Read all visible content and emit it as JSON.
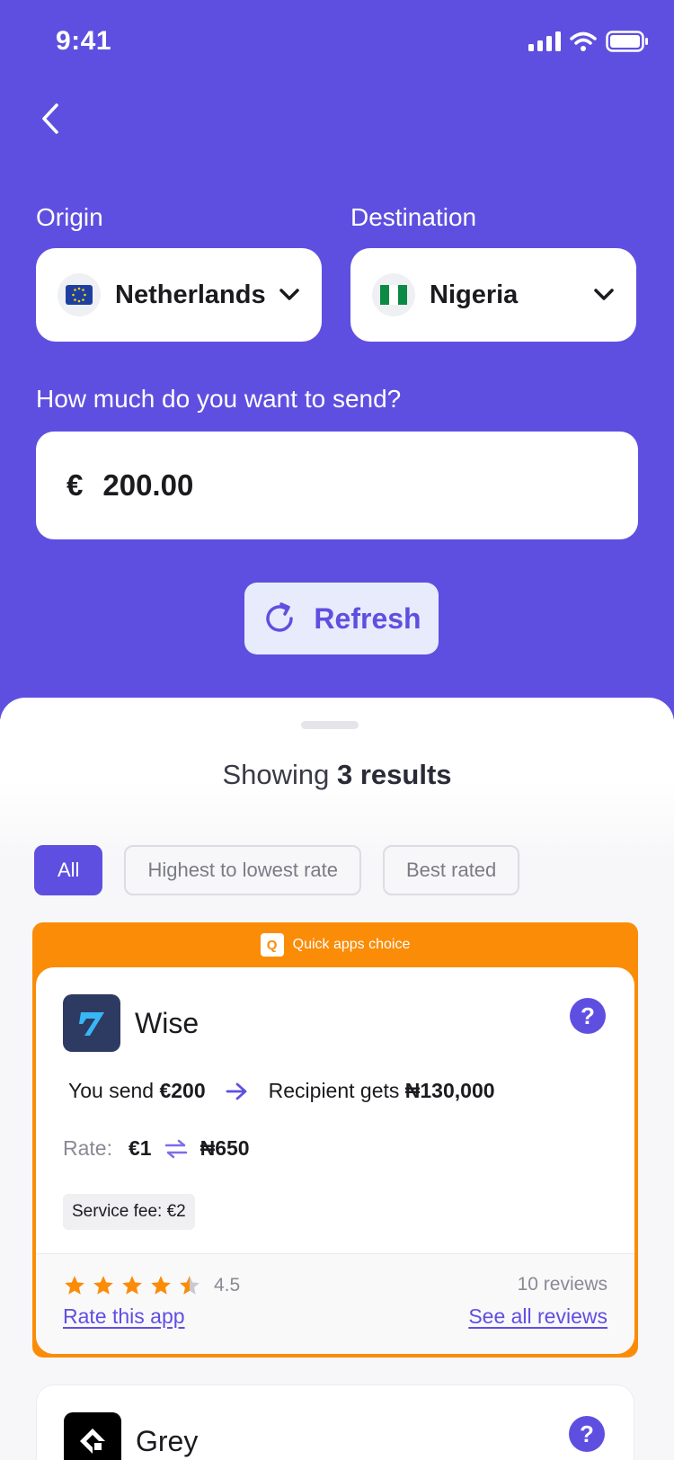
{
  "status_bar": {
    "time": "9:41"
  },
  "origin": {
    "label": "Origin",
    "country": "Netherlands"
  },
  "destination": {
    "label": "Destination",
    "country": "Nigeria"
  },
  "amount": {
    "question": "How much do you want to send?",
    "currency_symbol": "€",
    "value": "200.00"
  },
  "refresh": {
    "label": "Refresh"
  },
  "results": {
    "prefix": "Showing",
    "count_text": "3 results"
  },
  "filters": [
    {
      "label": "All",
      "active": true
    },
    {
      "label": "Highest to lowest rate",
      "active": false
    },
    {
      "label": "Best rated",
      "active": false
    }
  ],
  "featured": {
    "badge_icon_text": "Q",
    "badge_text": "Quick apps choice",
    "provider": "Wise",
    "help_symbol": "?",
    "send_prefix": "You send",
    "send_amount": "€200",
    "receive_prefix": "Recipient gets",
    "receive_amount": "₦130,000",
    "rate_label": "Rate:",
    "rate_from": "€1",
    "rate_to": "₦650",
    "service_fee": "Service fee: €2",
    "rating": 4.5,
    "rating_text": "4.5",
    "reviews_text": "10 reviews",
    "rate_link": "Rate this app",
    "see_reviews_link": "See all reviews"
  },
  "second": {
    "provider": "Grey",
    "help_symbol": "?"
  },
  "colors": {
    "primary": "#5f4fe0",
    "accent": "#fb8c08"
  }
}
